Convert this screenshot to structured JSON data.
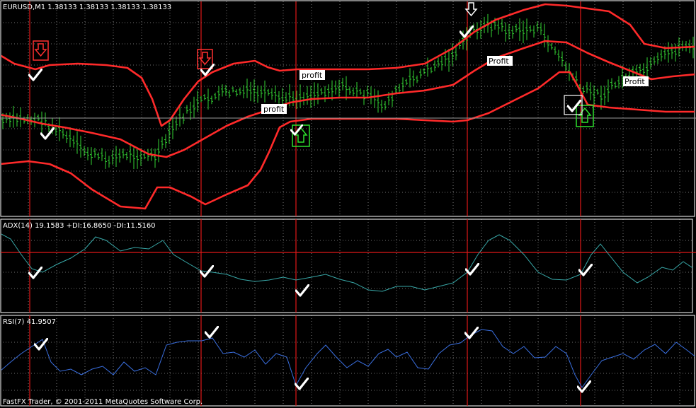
{
  "main_panel": {
    "header": "EURUSD,M1  1.38133 1.38133 1.38133 1.38133",
    "price_line_label": "1.38133"
  },
  "adx_panel": {
    "header": "ADX(14) 19.1583 +DI:16.8650 -DI:11.5160"
  },
  "rsi_panel": {
    "header": "RSI(7) 41.9507"
  },
  "footer": {
    "copyright": "FastFX Trader, © 2001-2011 MetaQuotes Software Corp."
  },
  "profit_tags": [
    "profit",
    "profit",
    "Profit",
    "Profit"
  ],
  "signals": {
    "sell_arrows": 3,
    "buy_arrows": 2
  },
  "colors": {
    "background": "#000000",
    "grid": "#c8c8c8",
    "bands": "#ff2a2a",
    "bars": "#34d334",
    "adx_line": "#38a8a8",
    "rsi_line": "#3a6fe0",
    "vertical_markers": "#e01818",
    "panel_border": "#ffffff",
    "sell_arrow": "#ff3030",
    "buy_arrow": "#2ee02e"
  },
  "icons": [
    "down-arrow-icon",
    "up-arrow-icon",
    "checkmark-icon"
  ]
}
